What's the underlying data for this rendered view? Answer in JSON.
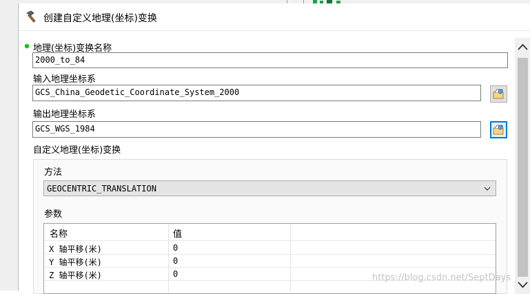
{
  "dialog": {
    "title": "创建自定义地理(坐标)变换"
  },
  "form": {
    "transform_name_label": "地理(坐标)变换名称",
    "transform_name_value": "2000_to_84",
    "input_gcs_label": "输入地理坐标系",
    "input_gcs_value": "GCS_China_Geodetic_Coordinate_System_2000",
    "output_gcs_label": "输出地理坐标系",
    "output_gcs_value": "GCS_WGS_1984",
    "custom_section_label": "自定义地理(坐标)变换",
    "method_label": "方法",
    "method_value": "GEOCENTRIC_TRANSLATION",
    "params_label": "参数"
  },
  "params_table": {
    "headers": [
      "名称",
      "值"
    ],
    "rows": [
      {
        "name": "X 轴平移(米)",
        "value": "0"
      },
      {
        "name": "Y 轴平移(米)",
        "value": "0"
      },
      {
        "name": "Z 轴平移(米)",
        "value": "0"
      }
    ]
  },
  "watermark": "https://blog.csdn.net/SeptDays",
  "colors": {
    "required_dot": "#16c60c",
    "focus_border": "#0078d7",
    "scroll_thumb": "#c2c2c2"
  }
}
